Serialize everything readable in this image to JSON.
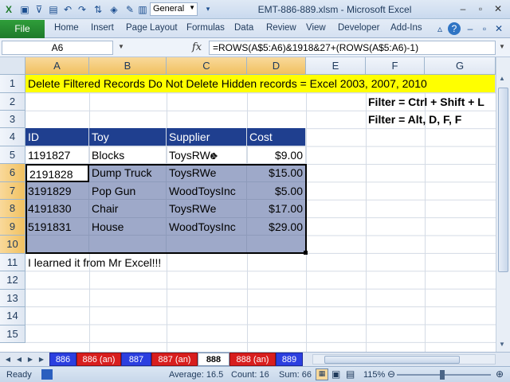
{
  "titlebar": {
    "title": "EMT-886-889.xlsm - Microsoft Excel",
    "qat_format": "General",
    "icons": [
      "excel-icon",
      "save-icon",
      "filter-icon",
      "new-icon",
      "undo-icon",
      "redo-icon",
      "sort-icon",
      "clear-icon",
      "format-icon"
    ]
  },
  "ribbon": {
    "file": "File",
    "tabs": [
      "Home",
      "Insert",
      "Page Layout",
      "Formulas",
      "Data",
      "Review",
      "View",
      "Developer",
      "Add-Ins"
    ]
  },
  "formula_bar": {
    "name_box": "A6",
    "fx": "fx",
    "formula": "=ROWS(A$5:A6)&1918&27+(ROWS(A$5:A6)-1)"
  },
  "columns": [
    "A",
    "B",
    "C",
    "D",
    "E",
    "F",
    "G"
  ],
  "rows": [
    "1",
    "2",
    "3",
    "4",
    "5",
    "6",
    "7",
    "8",
    "9",
    "10",
    "11",
    "12",
    "13",
    "14",
    "15"
  ],
  "cells": {
    "banner": "Delete Filtered Records Do Not Delete Hidden records = Excel 2003, 2007, 2010",
    "filter1": "Filter = Ctrl + Shift + L",
    "filter2": "Filter = Alt, D, F, F",
    "header": [
      "ID",
      "Toy",
      "Supplier",
      "Cost"
    ],
    "data": [
      [
        "1191827",
        "Blocks",
        "ToysRWe",
        "$9.00"
      ],
      [
        "2191828",
        "Dump Truck",
        "ToysRWe",
        "$15.00"
      ],
      [
        "3191829",
        "Pop Gun",
        "WoodToysInc",
        "$5.00"
      ],
      [
        "4191830",
        "Chair",
        "ToysRWe",
        "$17.00"
      ],
      [
        "5191831",
        "House",
        "WoodToysInc",
        "$29.00"
      ]
    ],
    "note": "I learned it from Mr Excel!!!"
  },
  "sheets": [
    {
      "name": "886",
      "style": "blue"
    },
    {
      "name": "886 (an)",
      "style": "red"
    },
    {
      "name": "887",
      "style": "blue"
    },
    {
      "name": "887 (an)",
      "style": "red"
    },
    {
      "name": "888",
      "style": "active"
    },
    {
      "name": "888 (an)",
      "style": "red"
    },
    {
      "name": "889",
      "style": "blue"
    }
  ],
  "status": {
    "ready": "Ready",
    "average": "Average: 16.5",
    "count": "Count: 16",
    "sum": "Sum: 66",
    "zoom": "115%"
  },
  "colors": {
    "banner": "#ffff00",
    "table_header": "#1f3f8f",
    "selection": "#9ea9c9",
    "file_tab": "#2f9e3a"
  }
}
